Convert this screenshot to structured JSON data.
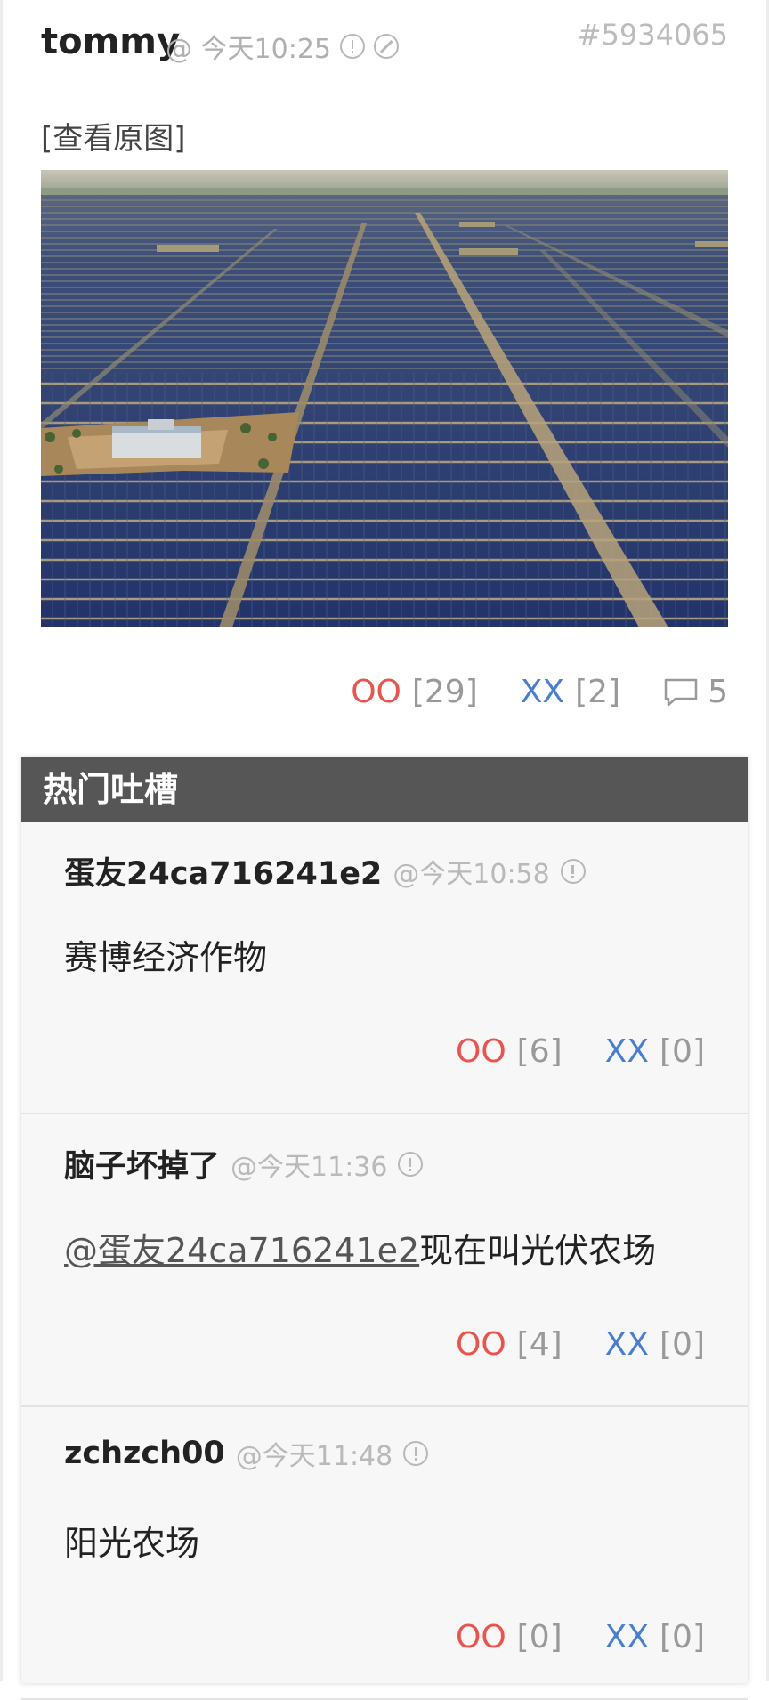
{
  "post": {
    "author": "tommy",
    "time": "@ 今天10:25",
    "id": "#5934065",
    "view_original": "[查看原图]",
    "oo_label": "OO",
    "oo_count": "[29]",
    "xx_label": "XX",
    "xx_count": "[2]",
    "comment_count": "5",
    "icons": [
      "report-icon",
      "block-icon",
      "comment-icon"
    ]
  },
  "hot_comments": {
    "title": "热门吐槽",
    "items": [
      {
        "author": "蛋友24ca716241e2",
        "time": "@今天10:58",
        "mention": "",
        "text": "赛博经济作物",
        "oo_label": "OO",
        "oo_count": "[6]",
        "xx_label": "XX",
        "xx_count": "[0]"
      },
      {
        "author": "脑子坏掉了",
        "time": "@今天11:36",
        "mention": "@蛋友24ca716241e2",
        "text": "现在叫光伏农场",
        "oo_label": "OO",
        "oo_count": "[4]",
        "xx_label": "XX",
        "xx_count": "[0]"
      },
      {
        "author": "zchzch00",
        "time": "@今天11:48",
        "mention": "",
        "text": "阳光农场",
        "oo_label": "OO",
        "oo_count": "[0]",
        "xx_label": "XX",
        "xx_count": "[0]"
      }
    ]
  },
  "colors": {
    "oo": "#e8554e",
    "xx": "#4a7fd0",
    "hot_header": "#565656"
  }
}
